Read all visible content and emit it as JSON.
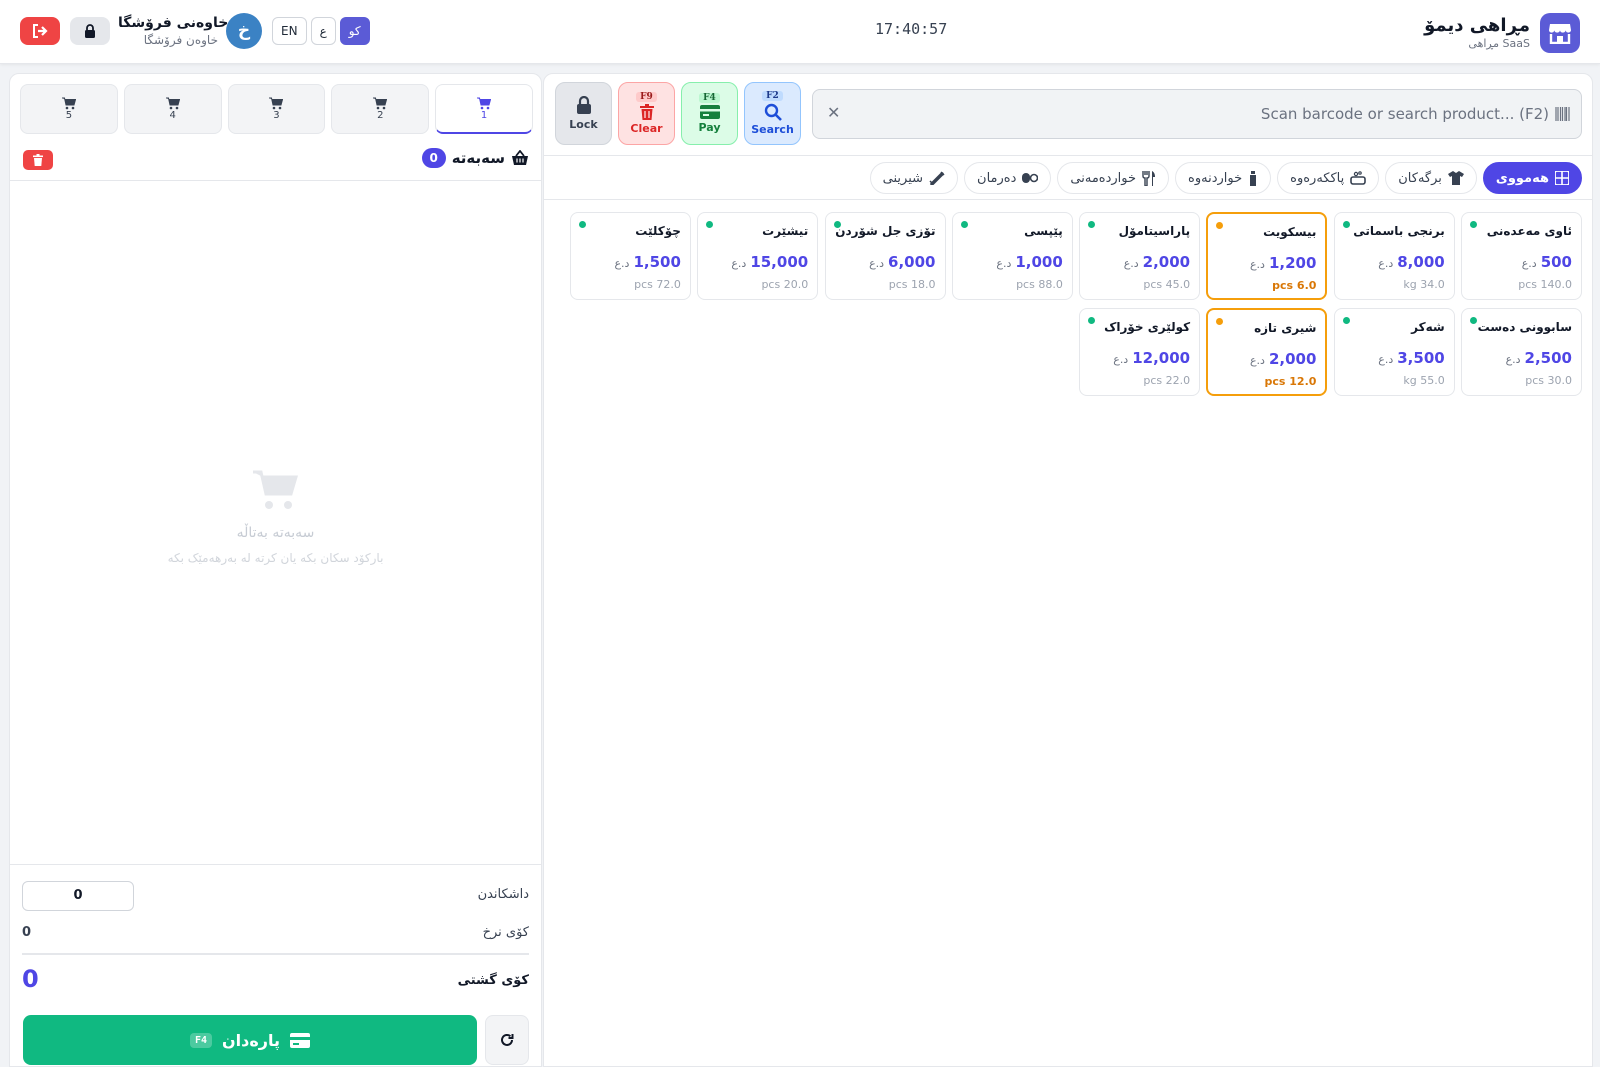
{
  "header": {
    "brand_name": "مڕاهی دیمۆ",
    "brand_sub": "مڕاهی SaaS",
    "clock": "17:40:57",
    "user_name": "خاوەنی فرۆشگا",
    "user_role": "خاوەن فرۆشگا",
    "avatar_letter": "خ",
    "languages": [
      "EN",
      "ع",
      "کو"
    ],
    "active_language": "کو",
    "icons": {
      "brand": "store-icon",
      "logout": "logout-icon",
      "lock": "lock-icon"
    }
  },
  "cart": {
    "tabs": [
      "1",
      "2",
      "3",
      "4",
      "5"
    ],
    "active_tab": "1",
    "title": "سەبەتە",
    "count": "0",
    "empty_title": "سەبەتە بەتاڵە",
    "empty_hint": "بارکۆد سکان بکە یان کرتە لە بەرهەمێک بکە",
    "discount_label": "داشکاندن",
    "discount_value": "0",
    "subtotal_label": "کۆی نرخ",
    "subtotal_value": "0",
    "total_label": "کۆی گشتی",
    "total_value": "0",
    "pay_label": "پارەدان",
    "pay_key": "F4"
  },
  "toolbar": {
    "lock_label": "Lock",
    "clear_label": "Clear",
    "clear_key": "F9",
    "pay_label": "Pay",
    "pay_key": "F4",
    "search_label": "Search",
    "search_key": "F2",
    "search_placeholder": "Scan barcode or search product... (F2)"
  },
  "categories": [
    {
      "label": "هەمووی",
      "icon": "grid-icon",
      "active": true
    },
    {
      "label": "برگەکان",
      "icon": "shirt-icon",
      "active": false
    },
    {
      "label": "پاککەرەوە",
      "icon": "soap-icon",
      "active": false
    },
    {
      "label": "خواردنەوە",
      "icon": "bottle-icon",
      "active": false
    },
    {
      "label": "خواردەمەنی",
      "icon": "utensils-icon",
      "active": false
    },
    {
      "label": "دەرمان",
      "icon": "pills-icon",
      "active": false
    },
    {
      "label": "شیرینی",
      "icon": "candy-icon",
      "active": false
    }
  ],
  "currency": "د.ع",
  "products": [
    {
      "name": "ئاوی مەعدەنی",
      "price": "500",
      "stock": "pcs 140.0",
      "low": false
    },
    {
      "name": "برنجی باسماتی",
      "price": "8,000",
      "stock": "kg 34.0",
      "low": false
    },
    {
      "name": "بیسکویت",
      "price": "1,200",
      "stock": "pcs 6.0",
      "low": true
    },
    {
      "name": "پاراسیتامۆل",
      "price": "2,000",
      "stock": "pcs 45.0",
      "low": false
    },
    {
      "name": "پێپسی",
      "price": "1,000",
      "stock": "pcs 88.0",
      "low": false
    },
    {
      "name": "تۆزی جل شۆردن",
      "price": "6,000",
      "stock": "pcs 18.0",
      "low": false
    },
    {
      "name": "تیشێرت",
      "price": "15,000",
      "stock": "pcs 20.0",
      "low": false
    },
    {
      "name": "چۆکلێت",
      "price": "1,500",
      "stock": "pcs 72.0",
      "low": false
    },
    {
      "name": "سابوونی دەست",
      "price": "2,500",
      "stock": "pcs 30.0",
      "low": false
    },
    {
      "name": "شەکر",
      "price": "3,500",
      "stock": "kg 55.0",
      "low": false
    },
    {
      "name": "شیری تازە",
      "price": "2,000",
      "stock": "pcs 12.0",
      "low": true
    },
    {
      "name": "کولێری خۆراک",
      "price": "12,000",
      "stock": "pcs 22.0",
      "low": false
    }
  ],
  "colors": {
    "primary": "#4f46e5",
    "success": "#10b981",
    "danger": "#ef4444",
    "warning": "#f59e0b"
  }
}
